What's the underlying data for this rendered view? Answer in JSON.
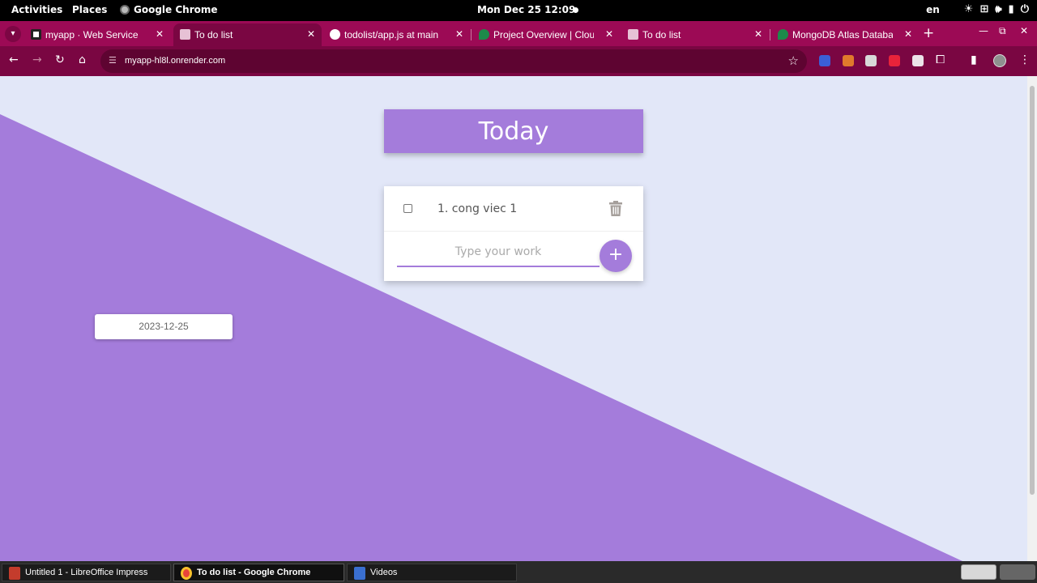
{
  "topbar": {
    "activities": "Activities",
    "places": "Places",
    "app": "Google Chrome",
    "clock": "Mon Dec 25  12:09",
    "lang": "en"
  },
  "tabs": [
    {
      "title": "myapp · Web Service",
      "active": false
    },
    {
      "title": "To do list",
      "active": true
    },
    {
      "title": "todolist/app.js at main",
      "active": false
    },
    {
      "title": "Project Overview | Clou",
      "active": false
    },
    {
      "title": "To do list",
      "active": false
    },
    {
      "title": "MongoDB Atlas Databa",
      "active": false
    }
  ],
  "browser": {
    "url": "myapp-hl8l.onrender.com",
    "theme_color": "#9c0a55"
  },
  "app": {
    "heading": "Today",
    "items": [
      {
        "text": "1. cong viec 1",
        "checked": false
      }
    ],
    "input_placeholder": "Type your work",
    "add_label": "+",
    "date": "2023-12-25",
    "accent": "#a47cdb",
    "background": "#e2e7f8"
  },
  "taskbar": {
    "items": [
      {
        "label": "Untitled 1 - LibreOffice Impress",
        "active": false
      },
      {
        "label": "To do list - Google Chrome",
        "active": true
      },
      {
        "label": "Videos",
        "active": false
      }
    ]
  }
}
